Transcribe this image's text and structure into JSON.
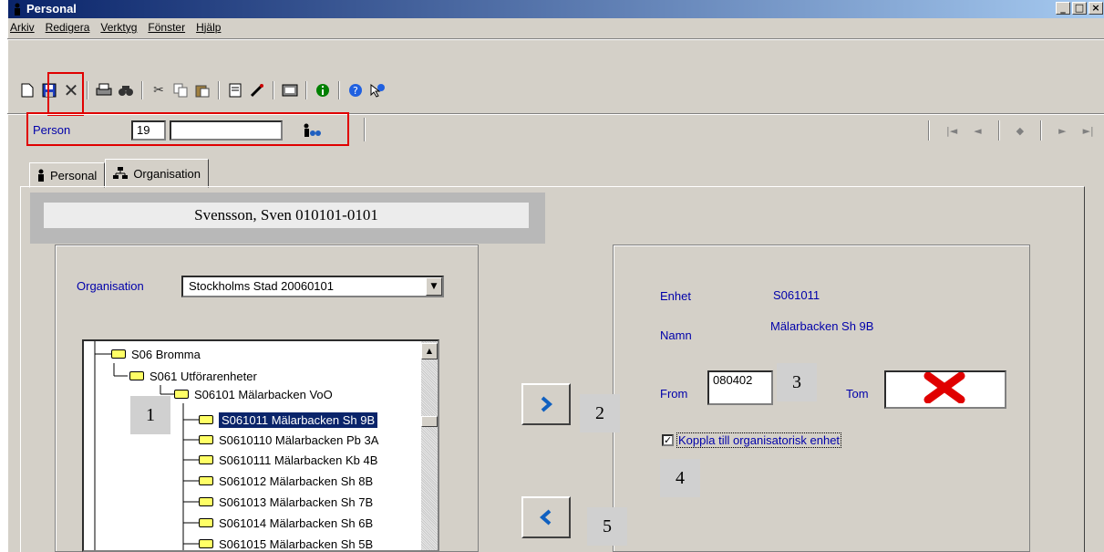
{
  "window": {
    "title": "Personal",
    "min": "_",
    "max": "□",
    "close": "×"
  },
  "menu": [
    "Arkiv",
    "Redigera",
    "Verktyg",
    "Fönster",
    "Hjälp"
  ],
  "toolbar": {
    "icons": [
      "new-icon",
      "save-icon",
      "delete-icon",
      "print-icon",
      "find-icon",
      "cut-icon",
      "copy-icon",
      "paste-icon",
      "report-icon",
      "tool-icon",
      "card-icon",
      "info-icon",
      "help-icon",
      "whats-this-icon"
    ]
  },
  "person": {
    "label": "Person",
    "id": "19",
    "name": ""
  },
  "nav": {
    "first": "|◄",
    "prev": "◄",
    "mid": "◆",
    "next": "►",
    "last": "►|"
  },
  "tabs": [
    {
      "label": "Personal"
    },
    {
      "label": "Organisation"
    }
  ],
  "header_name": "Svensson, Sven 010101-0101",
  "org": {
    "label": "Organisation",
    "selected": "Stockholms Stad 20060101"
  },
  "tree": [
    {
      "text": "S06  Bromma"
    },
    {
      "text": "S061  Utförarenheter"
    },
    {
      "text": "S06101  Mälarbacken VoO"
    },
    {
      "text": "S061011  Mälarbacken Sh 9B"
    },
    {
      "text": "S0610110  Mälarbacken Pb 3A"
    },
    {
      "text": "S0610111  Mälarbacken Kb 4B"
    },
    {
      "text": "S061012  Mälarbacken Sh 8B"
    },
    {
      "text": "S061013  Mälarbacken Sh 7B"
    },
    {
      "text": "S061014  Mälarbacken Sh 6B"
    },
    {
      "text": "S061015  Mälarbacken Sh 5B"
    }
  ],
  "detail": {
    "enhet_label": "Enhet",
    "enhet_value": "S061011",
    "namn_label": "Namn",
    "namn_value": "Mälarbacken Sh 9B",
    "from_label": "From",
    "from_value": "080402",
    "tom_label": "Tom",
    "tom_value": "",
    "checkbox_label": "Koppla till organisatorisk enhet",
    "checkbox_checked": true
  },
  "callouts": [
    "1",
    "2",
    "3",
    "4",
    "5"
  ],
  "colors": {
    "highlight": "#e00000",
    "selection": "#0a246a",
    "label_blue": "#0000aa",
    "folder": "#ffff66"
  }
}
